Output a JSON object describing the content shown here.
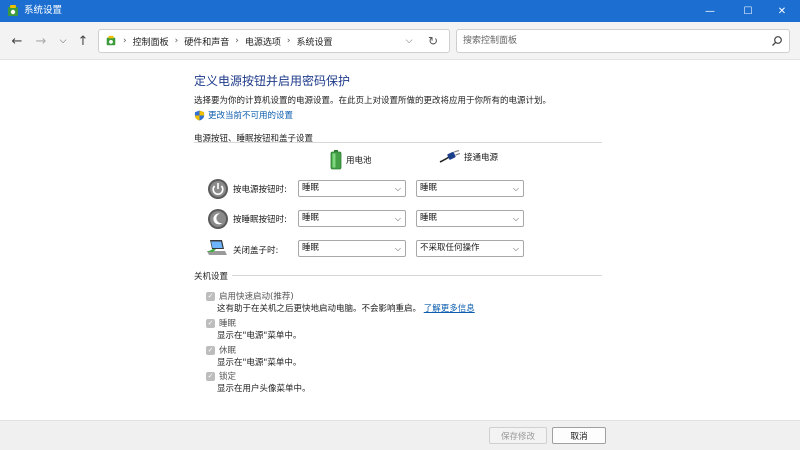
{
  "window": {
    "title": "系统设置"
  },
  "nav": {
    "breadcrumbs": [
      "控制面板",
      "硬件和声音",
      "电源选项",
      "系统设置"
    ],
    "search_placeholder": "搜索控制面板"
  },
  "page": {
    "title": "定义电源按钮并启用密码保护",
    "description": "选择要为你的计算机设置的电源设置。在此页上对设置所做的更改将应用于你所有的电源计划。",
    "change_link": "更改当前不可用的设置"
  },
  "power_section": {
    "title": "电源按钮、睡眠按钮和盖子设置",
    "col_battery": "用电池",
    "col_plugged": "接通电源",
    "rows": [
      {
        "label": "按电源按钮时:",
        "battery": "睡眠",
        "plugged": "睡眠"
      },
      {
        "label": "按睡眠按钮时:",
        "battery": "睡眠",
        "plugged": "睡眠"
      },
      {
        "label": "关闭盖子时:",
        "battery": "睡眠",
        "plugged": "不采取任何操作"
      }
    ]
  },
  "shutdown_section": {
    "title": "关机设置",
    "items": [
      {
        "label": "启用快速启动(推荐)",
        "desc": "这有助于在关机之后更快地启动电脑。不会影响重启。",
        "link": "了解更多信息",
        "checked": true
      },
      {
        "label": "睡眠",
        "desc": "显示在\"电源\"菜单中。",
        "checked": true
      },
      {
        "label": "休眠",
        "desc": "显示在\"电源\"菜单中。",
        "checked": true
      },
      {
        "label": "锁定",
        "desc": "显示在用户头像菜单中。",
        "checked": true
      }
    ]
  },
  "footer": {
    "save_label": "保存修改",
    "cancel_label": "取消"
  },
  "colors": {
    "titlebar": "#1c6fd0",
    "link": "#0b5cad",
    "title_text": "#1e3a8a"
  }
}
